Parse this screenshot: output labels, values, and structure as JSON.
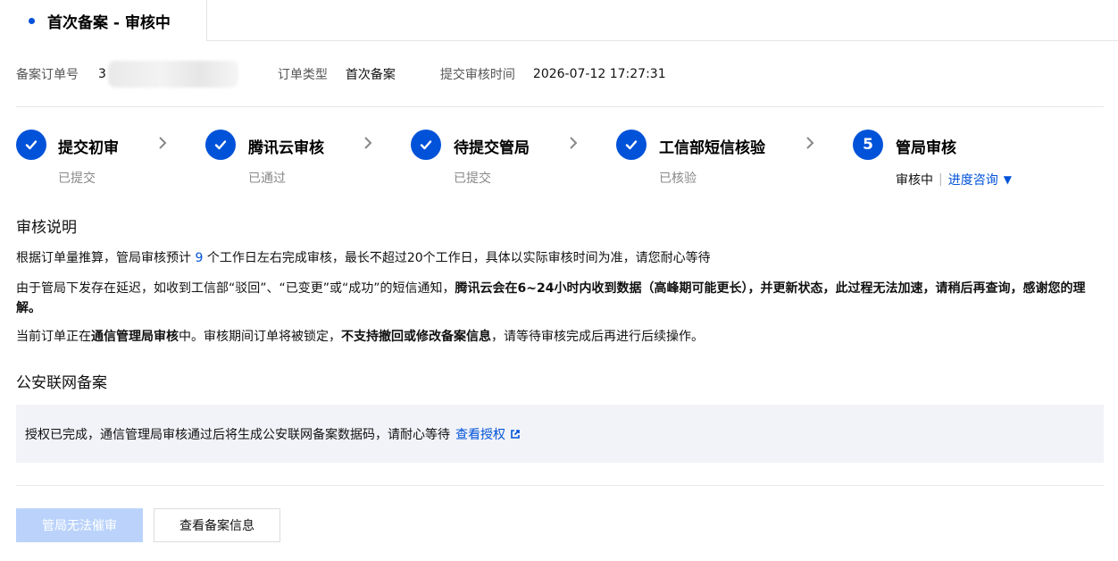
{
  "tab": {
    "title": "首次备案 - 审核中"
  },
  "meta": {
    "order_no_label": "备案订单号",
    "order_no_value": "3",
    "order_type_label": "订单类型",
    "order_type_value": "首次备案",
    "submit_time_label": "提交审核时间",
    "submit_time_value": "2026-07-12 17:27:31"
  },
  "steps": [
    {
      "title": "提交初审",
      "sub": "已提交",
      "icon": "check-icon"
    },
    {
      "title": "腾讯云审核",
      "sub": "已通过",
      "icon": "check-icon"
    },
    {
      "title": "待提交管局",
      "sub": "已提交",
      "icon": "check-icon"
    },
    {
      "title": "工信部短信核验",
      "sub": "已核验",
      "icon": "check-icon"
    },
    {
      "number": "5",
      "title": "管局审核",
      "status": "审核中",
      "separator": "|",
      "link": "进度咨询",
      "caret": "▼"
    }
  ],
  "review_notes": {
    "title": "审核说明",
    "p1_before": "根据订单量推算，管局审核预计",
    "p1_number": "9",
    "p1_after": "个工作日左右完成审核，最长不超过20个工作日，具体以实际审核时间为准，请您耐心等待",
    "p2_normal": "由于管局下发存在延迟，如收到工信部“驳回”、“已变更”或“成功”的短信通知，",
    "p2_bold": "腾讯云会在6~24小时内收到数据（高峰期可能更长），并更新状态，此过程无法加速，请稍后再查询，感谢您的理解。",
    "p3_a": "当前订单正在",
    "p3_b": "通信管理局审核",
    "p3_c": "中。审核期间订单将被锁定，",
    "p3_d": "不支持撤回或修改备案信息",
    "p3_e": "，请等待审核完成后再进行后续操作。"
  },
  "public_security": {
    "title": "公安联网备案",
    "notice_text": "授权已完成，通信管理局审核通过后将生成公安联网备案数据码，请耐心等待",
    "notice_link": "查看授权"
  },
  "buttons": {
    "urge": "管局无法催审",
    "view_info": "查看备案信息"
  },
  "colors": {
    "accent": "#0052d9",
    "disabled_button": "#bbd3fb",
    "notice_bg": "#f2f3f8"
  }
}
